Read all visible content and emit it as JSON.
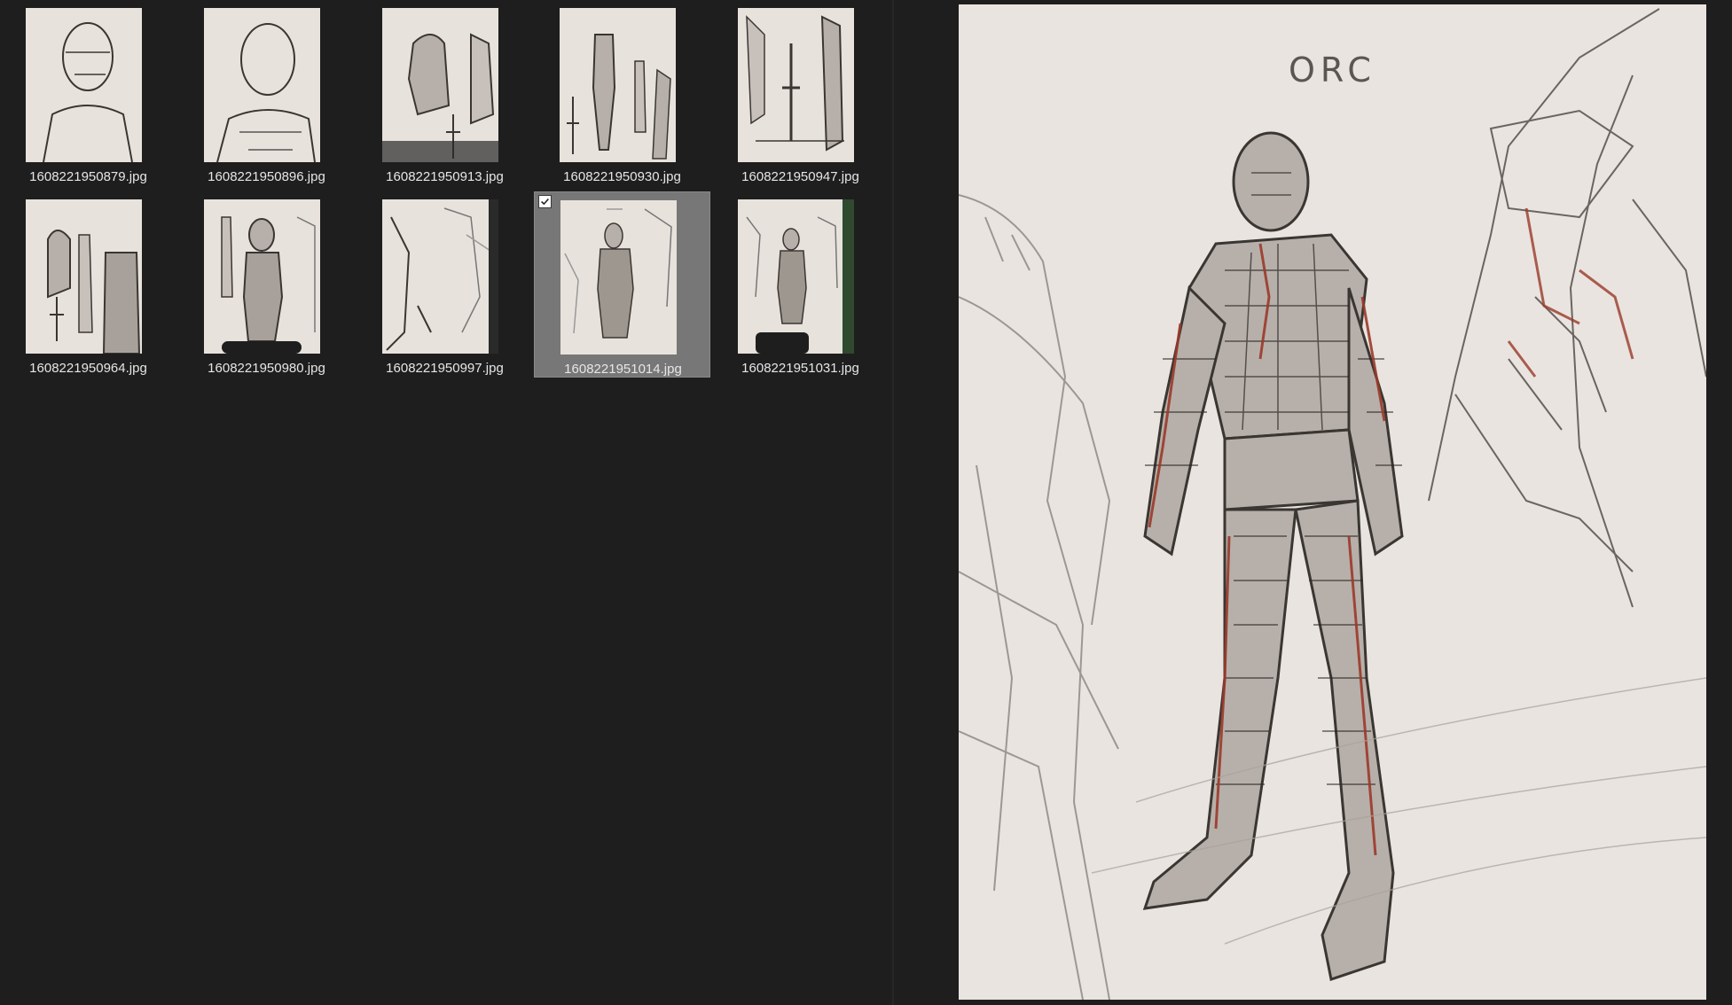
{
  "files": [
    {
      "name": "1608221950879.jpg",
      "selected": false
    },
    {
      "name": "1608221950896.jpg",
      "selected": false
    },
    {
      "name": "1608221950913.jpg",
      "selected": false
    },
    {
      "name": "1608221950930.jpg",
      "selected": false
    },
    {
      "name": "1608221950947.jpg",
      "selected": false
    },
    {
      "name": "1608221950964.jpg",
      "selected": false
    },
    {
      "name": "1608221950980.jpg",
      "selected": false
    },
    {
      "name": "1608221950997.jpg",
      "selected": false
    },
    {
      "name": "1608221951014.jpg",
      "selected": true
    },
    {
      "name": "1608221951031.jpg",
      "selected": false
    }
  ],
  "preview": {
    "title": "ORC",
    "file": "1608221951014.jpg"
  },
  "colors": {
    "background": "#1e1e1e",
    "selection": "#777777",
    "label_text": "#e6e6e6",
    "paper": "#e9e4df",
    "pencil": "#3a3632",
    "red_accent": "#9a3a2a"
  },
  "icons": {
    "checkbox": "checkmark-icon"
  }
}
